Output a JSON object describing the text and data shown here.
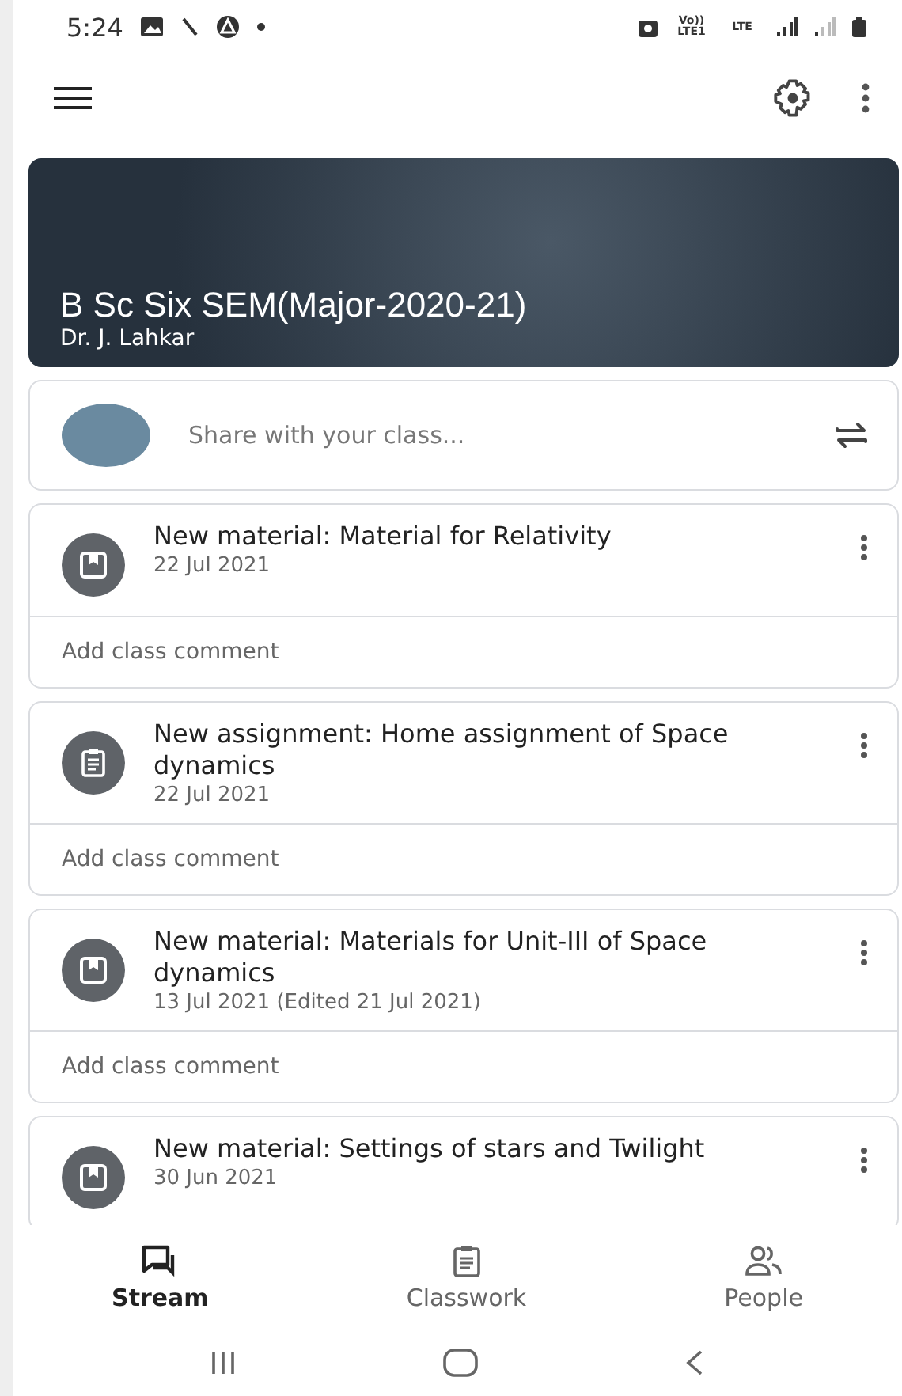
{
  "status_bar": {
    "time": "5:24",
    "network_label_1": "Vo)) LTE1",
    "network_label_2": "LTE"
  },
  "class_banner": {
    "title": "B Sc Six SEM(Major-2020-21)",
    "teacher": "Dr. J. Lahkar"
  },
  "share": {
    "placeholder": "Share with your class..."
  },
  "posts": [
    {
      "kind": "material",
      "title": "New material: Material for Relativity",
      "date": "22 Jul 2021",
      "comment_placeholder": "Add class comment"
    },
    {
      "kind": "assignment",
      "title": "New assignment: Home assignment of Space dynamics",
      "date": "22 Jul 2021",
      "comment_placeholder": "Add class comment"
    },
    {
      "kind": "material",
      "title": "New material: Materials for Unit-III of Space dynamics",
      "date": "13 Jul 2021 (Edited 21 Jul 2021)",
      "comment_placeholder": "Add class comment"
    },
    {
      "kind": "material",
      "title": "New material: Settings of stars and Twilight",
      "date": "30 Jun 2021"
    }
  ],
  "bottom_nav": [
    {
      "kind": "stream",
      "label": "Stream",
      "selected": true
    },
    {
      "kind": "classwork",
      "label": "Classwork",
      "selected": false
    },
    {
      "kind": "people",
      "label": "People",
      "selected": false
    }
  ]
}
